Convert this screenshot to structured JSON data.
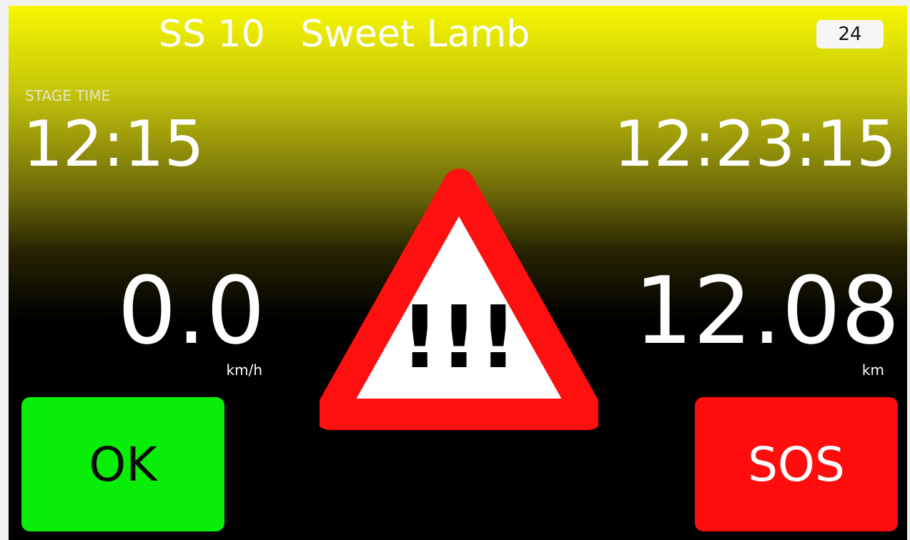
{
  "header": {
    "stage_title": "SS 10   Sweet Lamb",
    "badge": "24"
  },
  "stage_time": {
    "label": "STAGE TIME",
    "value": "12:15"
  },
  "clock": "12:23:15",
  "speed": {
    "value": "0.0",
    "unit": "km/h"
  },
  "distance": {
    "value": "12.08",
    "unit": "km"
  },
  "warning": {
    "icon": "warning-triangle-icon",
    "symbol": "!!!"
  },
  "buttons": {
    "ok_label": "OK",
    "sos_label": "SOS"
  },
  "colors": {
    "header_yellow": "#f7f700",
    "ok_green": "#08ee08",
    "sos_red": "#ff0d0d",
    "warning_red": "#ff1010"
  }
}
